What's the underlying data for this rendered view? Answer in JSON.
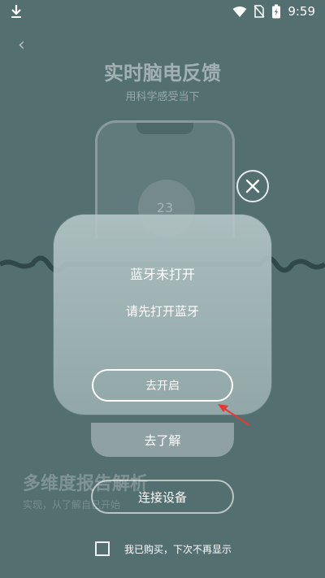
{
  "status_bar": {
    "time": "9:59",
    "icons": [
      "download-icon",
      "wifi-icon",
      "no-sim-icon",
      "battery-icon"
    ]
  },
  "background": {
    "title": "实时脑电反馈",
    "subtitle": "用科学感受当下",
    "phone_number": "23",
    "section_title": "多维度报告解析",
    "section_subtitle": "实现，从了解自己开始"
  },
  "dialog": {
    "title": "蓝牙未打开",
    "message": "请先打开蓝牙",
    "enable_button": "去开启"
  },
  "buttons": {
    "learn_more": "去了解",
    "connect_device": "连接设备"
  },
  "footer": {
    "checkbox_label": "我已购买，下次不再显示"
  },
  "colors": {
    "background": "#546f70",
    "arrow": "#e53935"
  }
}
